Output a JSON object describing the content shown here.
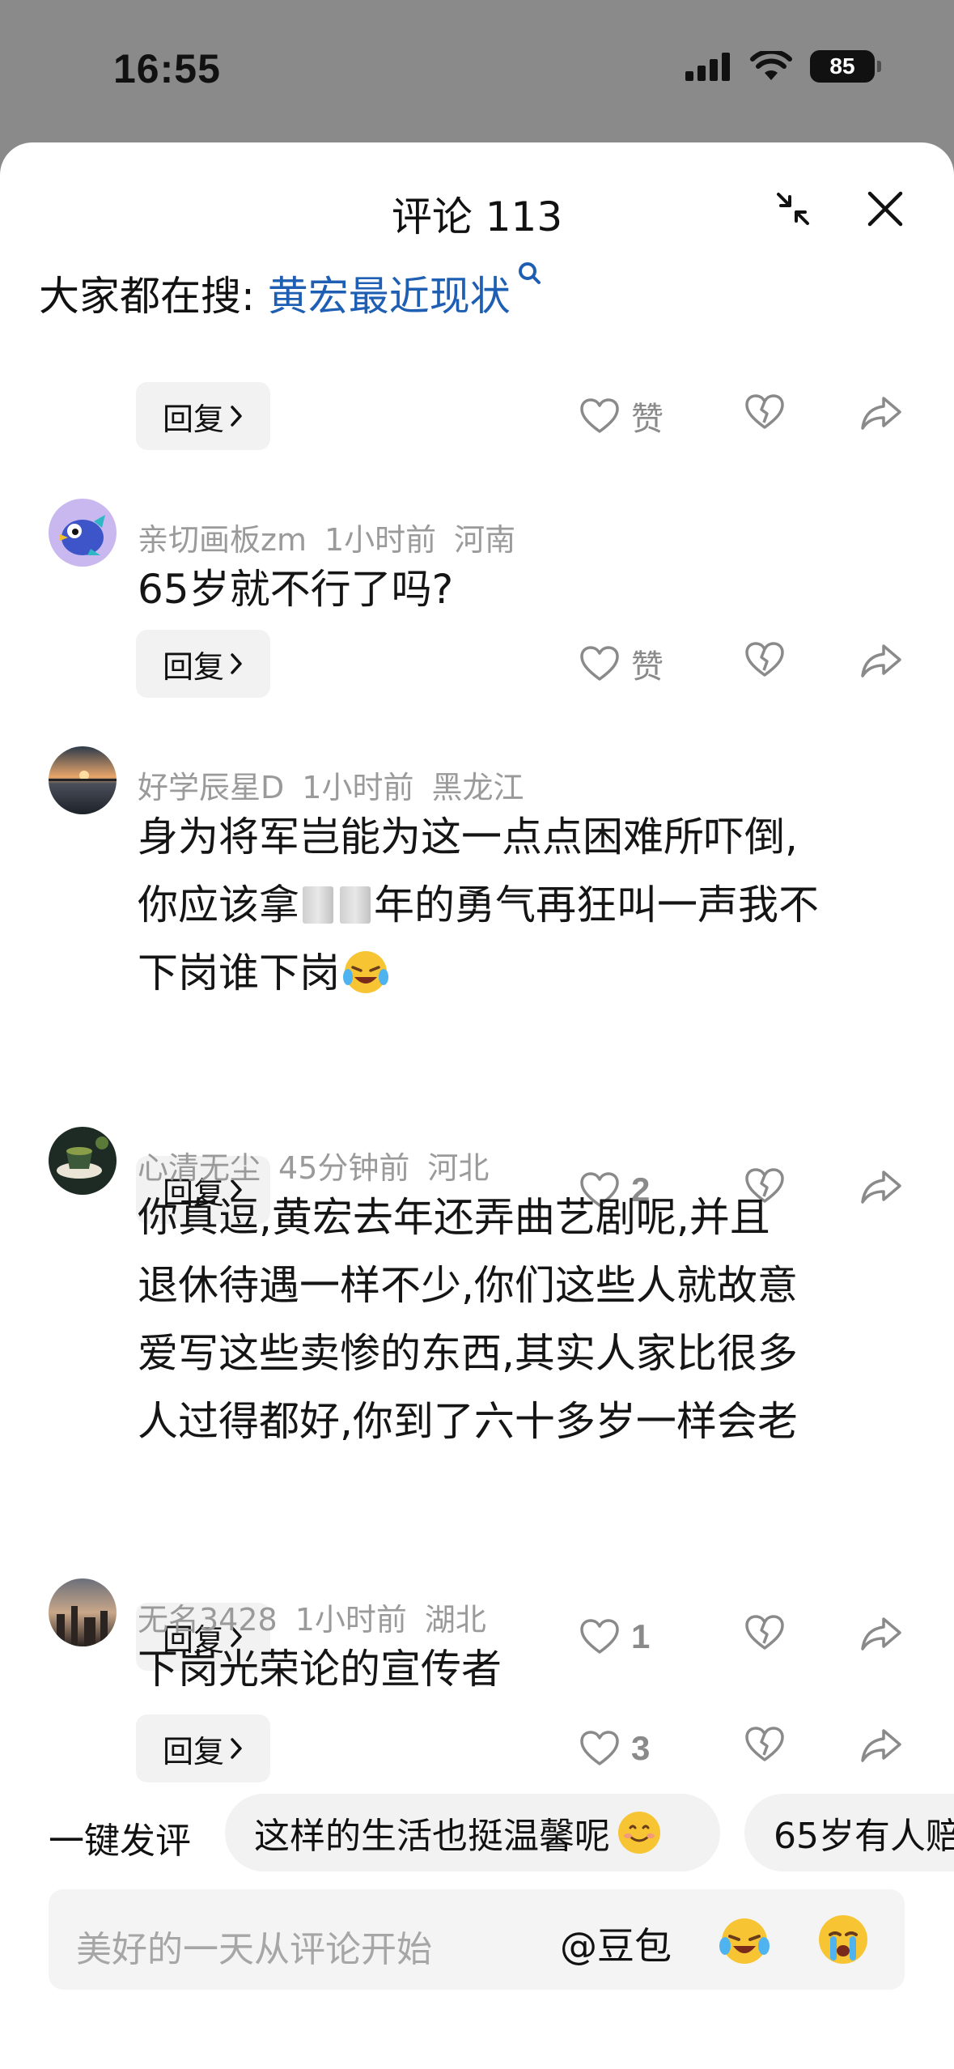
{
  "status_bar": {
    "time": "16:55",
    "battery": "85"
  },
  "header": {
    "title": "评论 113"
  },
  "trending": {
    "prefix": "大家都在搜: ",
    "query": "黄宏最近现状"
  },
  "reply_label": "回复",
  "top_actions": {
    "like_label": "赞"
  },
  "comments": [
    {
      "user": "亲切画板zm",
      "time": "1小时前",
      "location": "河南",
      "lines": [
        "65岁就不行了吗?"
      ],
      "like_label": "赞",
      "likes": ""
    },
    {
      "user": "好学辰星D",
      "time": "1小时前",
      "location": "黑龙江",
      "lines": [
        "身为将军岂能为这一点点困难所吓倒,",
        "你应该拿",
        "年的勇气再狂叫一声我不",
        "下岗谁下岗"
      ],
      "likes": "2"
    },
    {
      "user": "心清无尘",
      "time": "45分钟前",
      "location": "河北",
      "lines": [
        "你真逗,黄宏去年还弄曲艺剧呢,并且",
        "退休待遇一样不少,你们这些人就故意",
        "爱写这些卖惨的东西,其实人家比很多",
        "人过得都好,你到了六十多岁一样会老"
      ],
      "likes": "1"
    },
    {
      "user": "无名3428",
      "time": "1小时前",
      "location": "湖北",
      "lines": [
        "下岗光荣论的宣传者"
      ],
      "likes": "3"
    }
  ],
  "quick_comments": {
    "label": "一键发评",
    "chips": [
      "这样的生活也挺温馨呢",
      "65岁有人赔"
    ]
  },
  "input": {
    "placeholder": "美好的一天从评论开始",
    "mention": "@豆包"
  },
  "colors": {
    "link": "#1e5fb4",
    "meta": "#9a9a9a",
    "reply_bg": "#f2f2f2"
  }
}
